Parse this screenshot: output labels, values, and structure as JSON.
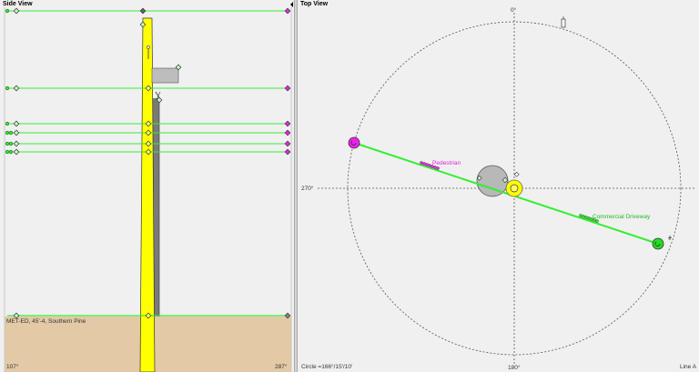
{
  "side_view": {
    "title": "Side View",
    "pole_label": "MET-ED, 45'-4, Southern Pine",
    "left_bearing": "107°",
    "right_bearing": "287°"
  },
  "top_view": {
    "title": "Top View",
    "compass": {
      "north": "0°",
      "west": "270°",
      "south": "180°"
    },
    "circle_readout": "Circle =166°/15'/10'",
    "line_readout": "Line A",
    "labels": {
      "pedestrian": "Pedestrian",
      "driveway": "Commercial Driveway",
      "pole_center": ""
    }
  },
  "colors": {
    "background": "#f0f0f0",
    "wire": "#33ee33",
    "pole": "#ffff00",
    "ground": "#e3c9a5",
    "anchor_magenta": "#ee22ee",
    "anchor_green": "#22dd22",
    "crossarm": "#bdbdbd",
    "guy": "#808080"
  },
  "icons": {
    "hardware-marker": "diamond",
    "anchor-marker": "circle",
    "insulator-icon": "pin",
    "transformer-icon": "small-can"
  }
}
